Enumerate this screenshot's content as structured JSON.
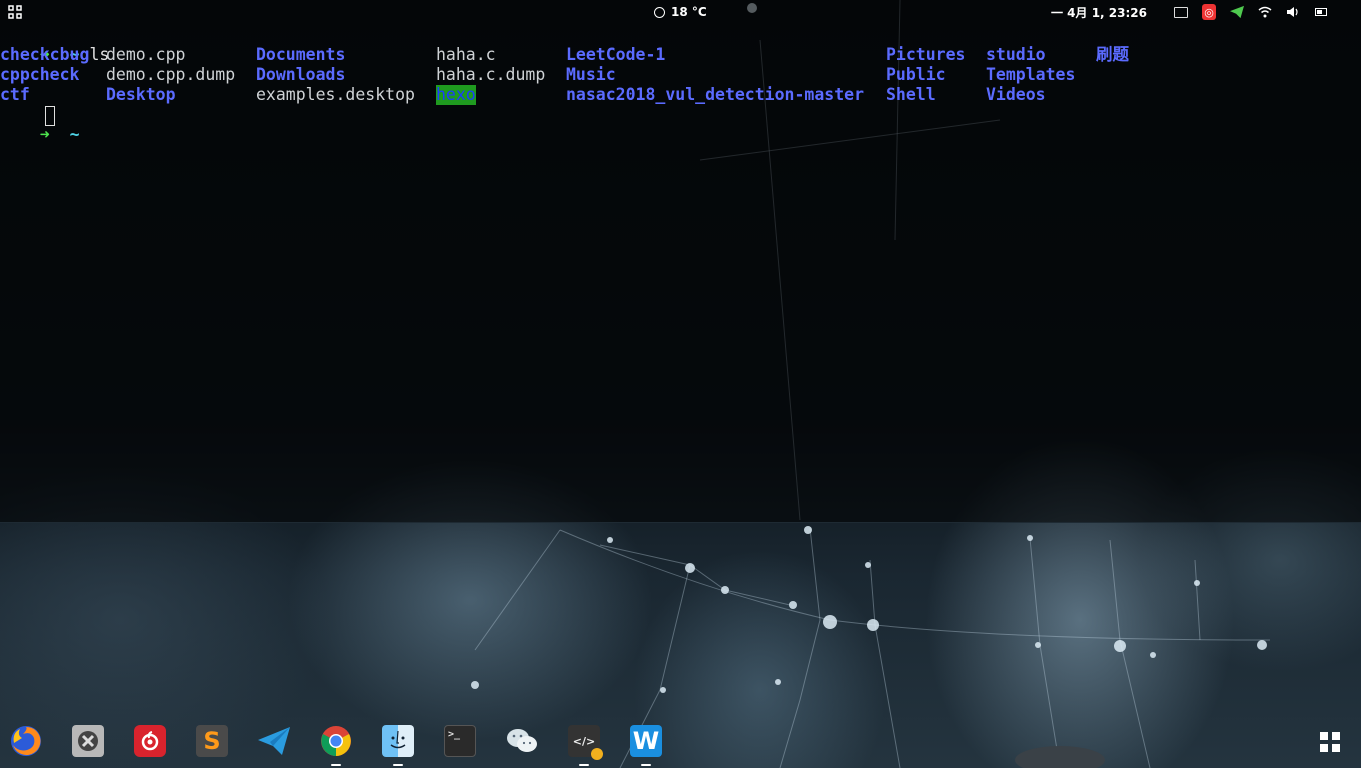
{
  "topbar": {
    "weather": "18 °C",
    "clock": "一 4月  1, 23:26",
    "tray_icons": [
      "keyboard-icon",
      "netease-music-icon",
      "telegram-icon",
      "wifi-icon",
      "volume-icon",
      "battery-icon"
    ]
  },
  "terminal": {
    "prompt_arrow": "➜",
    "prompt_dir": "~",
    "command": "ls",
    "entries": [
      {
        "name": "checkcbug",
        "type": "dir"
      },
      {
        "name": "cppcheck",
        "type": "dir"
      },
      {
        "name": "ctf",
        "type": "dir"
      },
      {
        "name": "demo.cpp",
        "type": "file"
      },
      {
        "name": "demo.cpp.dump",
        "type": "file"
      },
      {
        "name": "Desktop",
        "type": "dir"
      },
      {
        "name": "Documents",
        "type": "dir"
      },
      {
        "name": "Downloads",
        "type": "dir"
      },
      {
        "name": "examples.desktop",
        "type": "file"
      },
      {
        "name": "haha.c",
        "type": "file"
      },
      {
        "name": "haha.c.dump",
        "type": "file"
      },
      {
        "name": "hexo",
        "type": "dir-highlight"
      },
      {
        "name": "LeetCode-1",
        "type": "dir"
      },
      {
        "name": "Music",
        "type": "dir"
      },
      {
        "name": "nasac2018_vul_detection-master",
        "type": "dir"
      },
      {
        "name": "Pictures",
        "type": "dir"
      },
      {
        "name": "Public",
        "type": "dir"
      },
      {
        "name": "Shell",
        "type": "dir"
      },
      {
        "name": "studio",
        "type": "dir"
      },
      {
        "name": "Templates",
        "type": "dir"
      },
      {
        "name": "Videos",
        "type": "dir"
      },
      {
        "name": "刷题",
        "type": "dir"
      }
    ]
  },
  "dock": {
    "apps": [
      {
        "name": "firefox-icon",
        "running": false
      },
      {
        "name": "system-tools-icon",
        "running": false
      },
      {
        "name": "netease-music-icon",
        "running": false
      },
      {
        "name": "sublime-text-icon",
        "running": false,
        "glyph": "S"
      },
      {
        "name": "telegram-icon",
        "running": false
      },
      {
        "name": "chrome-icon",
        "running": true
      },
      {
        "name": "finder-icon",
        "running": true
      },
      {
        "name": "terminal-icon",
        "running": false,
        "glyph": ">_"
      },
      {
        "name": "wechat-icon",
        "running": false
      },
      {
        "name": "code-editor-icon",
        "running": true,
        "glyph": "</>"
      },
      {
        "name": "wps-writer-icon",
        "running": true,
        "glyph": "W"
      }
    ]
  },
  "colors": {
    "dir": "#5b6bff",
    "file": "#cfd3d6",
    "prompt_arrow": "#4ee44e",
    "prompt_tilde": "#4fd3e6",
    "highlight_bg": "#1f9a1f"
  }
}
